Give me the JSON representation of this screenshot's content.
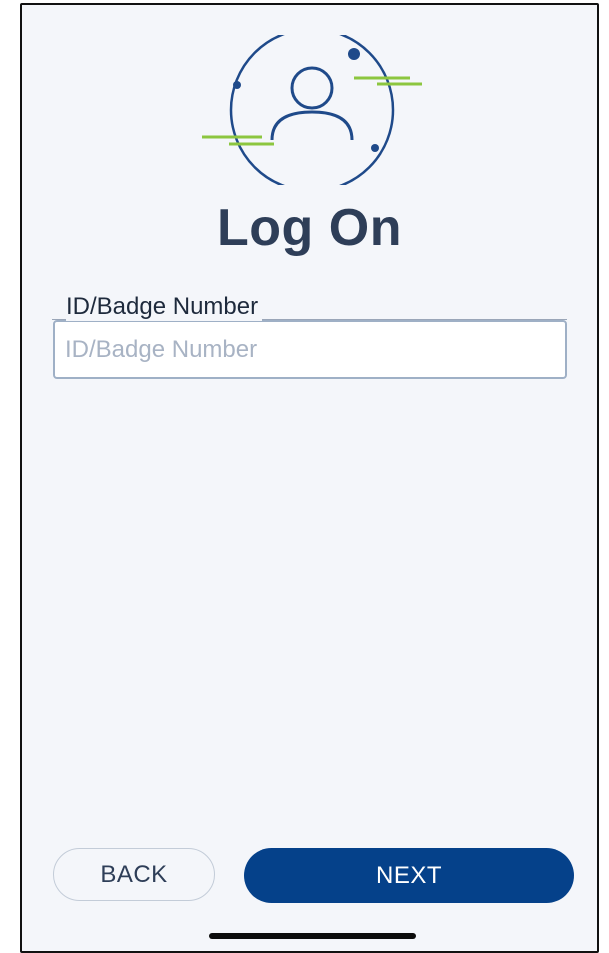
{
  "screen": {
    "title": "Log On"
  },
  "id_field": {
    "label": "ID/Badge Number",
    "placeholder": "ID/Badge Number",
    "value": ""
  },
  "actions": {
    "back_label": "BACK",
    "next_label": "NEXT"
  },
  "colors": {
    "primary": "#05418a",
    "title": "#2e3e58",
    "accent_green": "#8cc63f",
    "background": "#f4f6fa"
  },
  "icons": {
    "header": "user-profile-icon"
  }
}
